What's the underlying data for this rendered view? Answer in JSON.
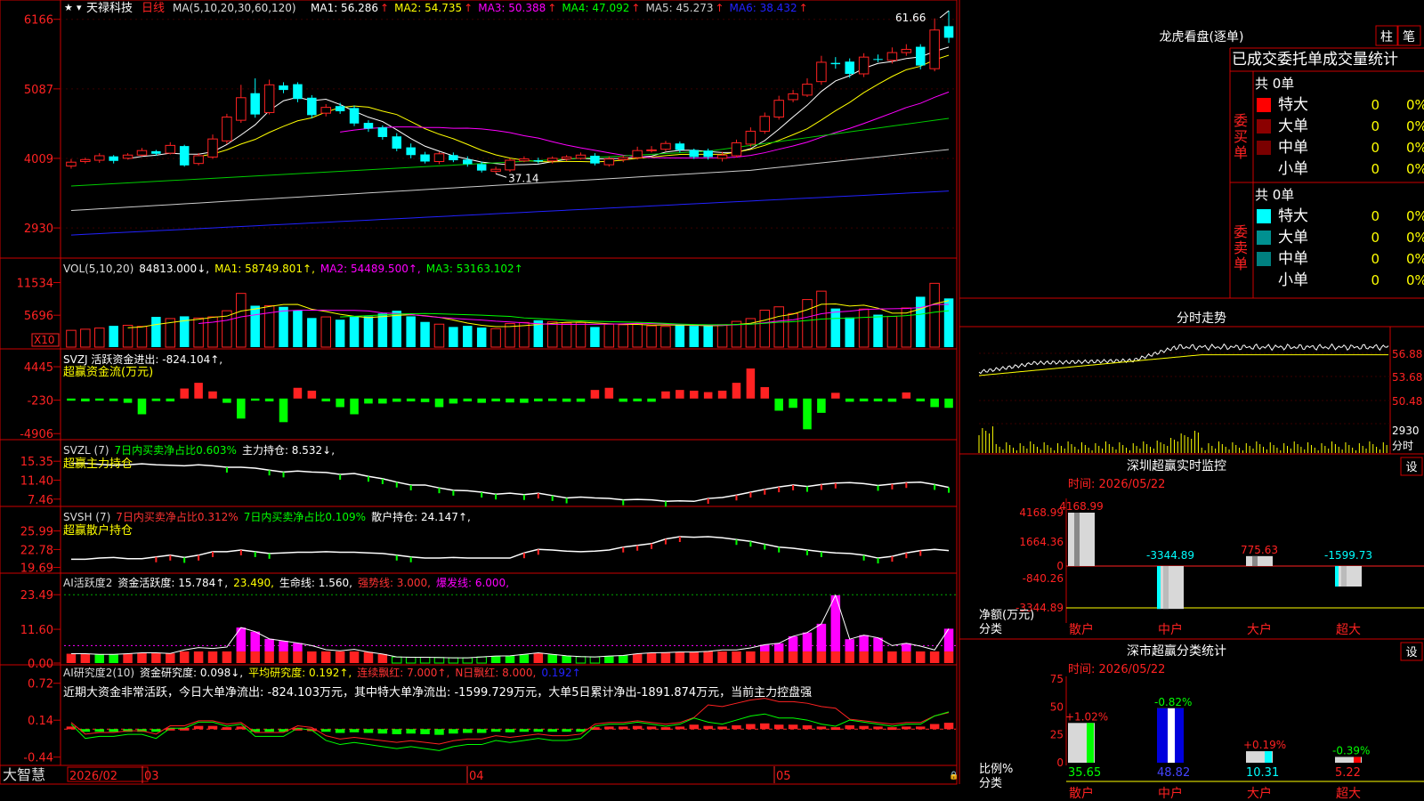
{
  "header": {
    "stock_name": "天禄科技",
    "period": "日线",
    "ma_label": "MA(5,10,20,30,60,120)",
    "ma": [
      {
        "t": "MA1: 56.286",
        "c": "#ffffff",
        "a": "up"
      },
      {
        "t": "MA2: 54.735",
        "c": "#ffff00",
        "a": "up"
      },
      {
        "t": "MA3: 50.388",
        "c": "#ff00ff",
        "a": "up"
      },
      {
        "t": "MA4: 47.092",
        "c": "#00ff00",
        "a": "up"
      },
      {
        "t": "MA5: 45.273",
        "c": "#cccccc",
        "a": "up"
      },
      {
        "t": "MA6: 38.432",
        "c": "#2222ff",
        "a": "up"
      }
    ]
  },
  "arrows": {
    "up": "↑",
    "down": "↓"
  },
  "panels": [
    {
      "id": "price",
      "ticks": [
        "6166",
        "5087",
        "4009",
        "2930"
      ]
    },
    {
      "id": "vol",
      "ticks": [
        "11534",
        "5696"
      ],
      "extra": "X10",
      "labels": [
        {
          "t": "VOL(5,10,20)",
          "c": "#dddddd"
        },
        {
          "t": "84813.000↓,",
          "c": "#ffffff"
        },
        {
          "t": "MA1: 58749.801↑,",
          "c": "#ffff00"
        },
        {
          "t": "MA2: 54489.500↑,",
          "c": "#ff00ff"
        },
        {
          "t": "MA3: 53163.102↑",
          "c": "#00ff00"
        }
      ]
    },
    {
      "id": "svzj",
      "ticks": [
        "4445",
        "-230",
        "-4906"
      ],
      "labels": [
        {
          "t": "SVZJ  活跃资金进出: -824.104↑,",
          "c": "#ffffff"
        }
      ],
      "sub": "超赢资金流(万元)"
    },
    {
      "id": "svzl",
      "ticks": [
        "15.35",
        "11.40",
        "7.46"
      ],
      "labels": [
        {
          "t": "SVZL (7)",
          "c": "#dddddd"
        },
        {
          "t": "7日内买卖净占比0.603%",
          "c": "#00ff00"
        },
        {
          "t": "主力持仓: 8.532↓,",
          "c": "#ffffff"
        }
      ],
      "sub": "超赢主力持仓"
    },
    {
      "id": "svsh",
      "ticks": [
        "25.99",
        "22.78",
        "19.69"
      ],
      "labels": [
        {
          "t": "SVSH (7)",
          "c": "#dddddd"
        },
        {
          "t": "7日内买卖净占比0.312%",
          "c": "#ff3333"
        },
        {
          "t": "7日内买卖净占比0.109%",
          "c": "#00ff00"
        },
        {
          "t": "散户持仓: 24.147↑,",
          "c": "#ffffff"
        }
      ],
      "sub": "超赢散户持仓"
    },
    {
      "id": "ai1",
      "ticks": [
        "23.49",
        "11.60",
        "0.00"
      ],
      "labels": [
        {
          "t": "AI活跃度2",
          "c": "#dddddd"
        },
        {
          "t": "资金活跃度: 15.784↑,",
          "c": "#ffffff"
        },
        {
          "t": "23.490,",
          "c": "#ffff00"
        },
        {
          "t": "生命线: 1.560,",
          "c": "#ffffff"
        },
        {
          "t": "强势线: 3.000,",
          "c": "#ff3333"
        },
        {
          "t": "爆发线: 6.000,",
          "c": "#ff00ff"
        }
      ]
    },
    {
      "id": "ai2",
      "ticks": [
        "0.72",
        "0.14",
        "-0.44"
      ],
      "labels": [
        {
          "t": "AI研究度2(10)",
          "c": "#dddddd"
        },
        {
          "t": "资金研究度: 0.098↓,",
          "c": "#ffffff"
        },
        {
          "t": "平均研究度: 0.192↑,",
          "c": "#ffff00"
        },
        {
          "t": "连续飘红: 7.000↑,",
          "c": "#ff3333"
        },
        {
          "t": "N日飘红: 8.000,",
          "c": "#ff3333"
        },
        {
          "t": "0.192↑",
          "c": "#2222ff"
        }
      ],
      "sub": "近期大资金非常活跃，今日大单净流出: -824.103万元，其中特大单净流出: -1599.729万元，大单5日累计净出-1891.874万元，当前主力控盘强"
    }
  ],
  "annotations": {
    "high": "61.66",
    "low": "37.14"
  },
  "bottom": {
    "brand": "大智慧",
    "dates": [
      "2026/02",
      "03",
      "04",
      "05"
    ]
  },
  "longhu": {
    "title": "龙虎看盘(逐单)",
    "btn1": "柱",
    "btn2": "笔",
    "header": "已成交委托单成交量统计",
    "buy": {
      "label": "委买单",
      "total": "共 0单",
      "rows": [
        {
          "name": "特大",
          "val": "0",
          "pct": "0%",
          "c": "#ff0000"
        },
        {
          "name": "大单",
          "val": "0",
          "pct": "0%",
          "c": "#8b0000"
        },
        {
          "name": "中单",
          "val": "0",
          "pct": "0%",
          "c": "#7a0000"
        },
        {
          "name": "小单",
          "val": "0",
          "pct": "0%",
          "c": ""
        }
      ]
    },
    "sell": {
      "label": "委卖单",
      "total": "共 0单",
      "rows": [
        {
          "name": "特大",
          "val": "0",
          "pct": "0%",
          "c": "#00ffff"
        },
        {
          "name": "大单",
          "val": "0",
          "pct": "0%",
          "c": "#009090"
        },
        {
          "name": "中单",
          "val": "0",
          "pct": "0%",
          "c": "#008080"
        },
        {
          "name": "小单",
          "val": "0",
          "pct": "0%",
          "c": ""
        }
      ]
    }
  },
  "minute": {
    "title": "分时走势",
    "ticks": [
      "56.88",
      "53.68",
      "50.48"
    ],
    "vol_tick": "2930",
    "vol_unit": "分时"
  },
  "monitor": {
    "title": "深圳超赢实时监控",
    "btn": "设",
    "time": "时间: 2026/05/22",
    "ticks": [
      "4168.99",
      "1664.36",
      "0",
      "-840.26",
      "-3344.89"
    ],
    "ylabel": "净额(万元)",
    "xlabel": "分类",
    "cats": [
      "散户",
      "中户",
      "大户",
      "超大"
    ],
    "vals": [
      "4168.99",
      "-3344.89",
      "775.63",
      "-1599.73"
    ]
  },
  "classify": {
    "title": "深市超赢分类统计",
    "btn": "设",
    "time": "时间: 2026/05/22",
    "ticks": [
      "75",
      "50",
      "25",
      "0"
    ],
    "ylabel": "比例%",
    "xlabel": "分类",
    "cats": [
      "散户",
      "中户",
      "大户",
      "超大"
    ],
    "vals": [
      "35.65",
      "48.82",
      "10.31",
      "5.22"
    ],
    "chg": [
      "+1.02%",
      "-0.82%",
      "+0.19%",
      "-0.39%"
    ]
  },
  "chart_data": [
    {
      "type": "candlestick",
      "title": "天禄科技 日线",
      "x": [
        "2026/02",
        "03",
        "04",
        "05"
      ],
      "yticks": [
        2930,
        4009,
        5087,
        6166
      ],
      "ylim": [
        2600,
        6300
      ],
      "high_label": 61.66,
      "low_label": 37.14,
      "o": [
        3890,
        3960,
        3980,
        4040,
        4010,
        4060,
        4120,
        4090,
        4200,
        3930,
        4030,
        4280,
        4600,
        5020,
        4720,
        5140,
        5160,
        4950,
        4710,
        4820,
        4790,
        4560,
        4490,
        4350,
        4180,
        4070,
        3960,
        4060,
        3990,
        3920,
        3810,
        3830,
        3970,
        3980,
        3970,
        4000,
        4010,
        4050,
        3910,
        3990,
        4020,
        4140,
        4150,
        4240,
        4140,
        4130,
        4010,
        4050,
        4230,
        4430,
        4650,
        4920,
        4990,
        5200,
        5490,
        5510,
        5320,
        5550,
        5530,
        5650,
        5740,
        5400,
        6060
      ],
      "c": [
        3950,
        3990,
        4050,
        3970,
        4060,
        4130,
        4080,
        4210,
        3900,
        4050,
        4310,
        4650,
        4950,
        4690,
        5150,
        5070,
        4930,
        4680,
        4800,
        4740,
        4550,
        4470,
        4340,
        4160,
        4060,
        3960,
        4080,
        3980,
        3920,
        3820,
        3840,
        3980,
        4000,
        3960,
        4010,
        4030,
        4060,
        3930,
        4000,
        4020,
        4130,
        4140,
        4240,
        4140,
        4030,
        4030,
        4060,
        4250,
        4430,
        4660,
        4910,
        5010,
        5160,
        5500,
        5470,
        5320,
        5580,
        5540,
        5650,
        5700,
        5450,
        6000,
        5880
      ],
      "h": [
        4000,
        4020,
        4090,
        4060,
        4090,
        4170,
        4140,
        4260,
        4220,
        4090,
        4380,
        4700,
        5150,
        5250,
        5230,
        5190,
        5190,
        4990,
        4850,
        4870,
        4830,
        4600,
        4520,
        4400,
        4240,
        4110,
        4110,
        4100,
        4040,
        3960,
        3880,
        4010,
        4040,
        4020,
        4040,
        4060,
        4100,
        4090,
        4040,
        4050,
        4190,
        4200,
        4280,
        4270,
        4160,
        4160,
        4110,
        4300,
        4490,
        4720,
        4980,
        5070,
        5250,
        5600,
        5580,
        5560,
        5640,
        5620,
        5730,
        5780,
        5780,
        6180,
        6300
      ],
      "l": [
        3850,
        3930,
        3940,
        3930,
        3990,
        4040,
        4050,
        4070,
        3880,
        3900,
        4000,
        4230,
        4560,
        4640,
        4690,
        5020,
        4880,
        4630,
        4660,
        4700,
        4510,
        4420,
        4300,
        4120,
        4010,
        3930,
        3920,
        3950,
        3880,
        3790,
        3770,
        3800,
        3950,
        3930,
        3930,
        3970,
        3990,
        3900,
        3880,
        3950,
        3990,
        4100,
        4120,
        4100,
        4000,
        3990,
        3960,
        4020,
        4190,
        4390,
        4610,
        4880,
        4960,
        5150,
        5400,
        5260,
        5270,
        5500,
        5480,
        5600,
        5390,
        5360,
        5800
      ]
    },
    {
      "type": "bar",
      "title": "VOL(5,10,20)",
      "yticks": [
        5696,
        11534
      ],
      "ylim": [
        0,
        14000
      ],
      "values": [
        3000,
        3200,
        3400,
        3800,
        3900,
        3700,
        5400,
        5100,
        5500,
        5200,
        5400,
        6500,
        9600,
        7400,
        7400,
        7200,
        6600,
        5200,
        5400,
        4900,
        5400,
        5500,
        6000,
        6500,
        5500,
        4500,
        4100,
        3600,
        3800,
        3500,
        3300,
        4200,
        4400,
        4800,
        4500,
        4300,
        4400,
        3600,
        4100,
        4000,
        4200,
        3800,
        3700,
        4000,
        3800,
        3800,
        4000,
        4600,
        5100,
        6600,
        7200,
        6000,
        8500,
        10000,
        6900,
        5300,
        6800,
        5800,
        5500,
        7000,
        9000,
        11400,
        8700
      ]
    },
    {
      "type": "bar",
      "title": "超赢资金流(万元)",
      "yticks": [
        -4906,
        -230,
        4445
      ],
      "ylim": [
        -5500,
        5200
      ],
      "values": [
        -300,
        -400,
        -300,
        -350,
        -600,
        -2200,
        -350,
        -400,
        1400,
        2200,
        1000,
        -600,
        -2800,
        -300,
        -400,
        -3300,
        1500,
        1100,
        -400,
        -1200,
        -2200,
        -700,
        -700,
        -450,
        -400,
        -500,
        -1200,
        -700,
        -400,
        -600,
        -400,
        -550,
        -600,
        -400,
        -350,
        -450,
        -450,
        1200,
        1500,
        -450,
        -400,
        -450,
        1000,
        1200,
        1100,
        900,
        1100,
        2200,
        4200,
        1600,
        -1700,
        -1300,
        -4300,
        -2000,
        800,
        -450,
        -400,
        -400,
        -450,
        850,
        -400,
        -1200,
        -1300
      ]
    },
    {
      "type": "line",
      "title": "超赢主力持仓",
      "yticks": [
        7.46,
        11.4,
        15.35
      ],
      "ylim": [
        6.5,
        16.5
      ],
      "values": [
        14.9,
        14.9,
        14.7,
        14.5,
        14.6,
        14.8,
        14.6,
        14.5,
        14.4,
        14.6,
        14.4,
        14.1,
        14.1,
        13.9,
        13.5,
        13.1,
        13.3,
        13.1,
        13.0,
        12.6,
        12.8,
        12.2,
        11.7,
        11.0,
        10.4,
        10.4,
        9.8,
        9.3,
        9.2,
        8.9,
        8.5,
        8.7,
        8.4,
        8.7,
        8.2,
        7.7,
        7.9,
        7.7,
        7.6,
        7.3,
        7.4,
        7.3,
        7.0,
        7.1,
        7.0,
        7.6,
        7.8,
        8.3,
        8.9,
        9.5,
        10.0,
        10.4,
        10.1,
        10.5,
        10.8,
        10.9,
        10.7,
        10.3,
        10.6,
        10.9,
        11.0,
        10.5,
        9.9
      ]
    },
    {
      "type": "line",
      "title": "超赢散户持仓",
      "yticks": [
        19.69,
        22.78,
        25.99
      ],
      "ylim": [
        19,
        27
      ],
      "values": [
        21.1,
        21.1,
        21.3,
        21.4,
        21.2,
        21.2,
        21.5,
        21.8,
        21.4,
        21.8,
        22.4,
        22.4,
        22.7,
        22.4,
        22.1,
        22.2,
        22.3,
        22.3,
        22.4,
        22.3,
        22.3,
        22.2,
        22.1,
        21.8,
        21.5,
        21.3,
        21.3,
        21.4,
        21.3,
        21.3,
        21.3,
        21.3,
        22.2,
        22.8,
        22.7,
        22.5,
        22.4,
        22.5,
        22.7,
        23.2,
        23.5,
        23.8,
        24.6,
        25.0,
        24.9,
        25.0,
        24.8,
        24.5,
        24.2,
        23.7,
        23.2,
        23.0,
        22.7,
        22.4,
        22.2,
        22.1,
        21.8,
        21.3,
        21.6,
        22.2,
        22.6,
        22.8,
        22.6
      ]
    },
    {
      "type": "bar",
      "title": "AI活跃度2",
      "yticks": [
        0,
        11.6,
        23.49
      ],
      "ylim": [
        0,
        26
      ],
      "values": [
        3.2,
        3.2,
        3.0,
        3.0,
        3.2,
        3.5,
        3.5,
        3.3,
        4.5,
        5.3,
        5.0,
        5.5,
        12.2,
        10.8,
        8.3,
        7.6,
        6.9,
        6.0,
        4.6,
        4.2,
        4.7,
        3.8,
        3.1,
        2.1,
        2.0,
        2.0,
        1.9,
        1.8,
        1.8,
        2.1,
        2.4,
        2.5,
        3.0,
        3.5,
        3.0,
        2.5,
        2.2,
        2.1,
        2.4,
        2.6,
        3.2,
        3.5,
        3.6,
        3.8,
        3.8,
        4.0,
        4.5,
        4.5,
        5.2,
        6.3,
        6.8,
        9.2,
        10.5,
        13.5,
        23.3,
        8.2,
        9.6,
        8.7,
        6.0,
        6.8,
        5.8,
        4.5,
        11.8
      ]
    },
    {
      "type": "bar",
      "title": "AI研究度2(10)",
      "yticks": [
        -0.44,
        0.14,
        0.72
      ],
      "ylim": [
        -0.5,
        0.8
      ],
      "values": [
        0.04,
        -0.03,
        -0.02,
        -0.02,
        -0.01,
        -0.01,
        -0.03,
        0.02,
        0.02,
        0.05,
        0.05,
        0.03,
        0.04,
        -0.02,
        -0.02,
        -0.02,
        0.02,
        0.01,
        -0.04,
        -0.06,
        -0.05,
        -0.06,
        -0.07,
        -0.08,
        -0.07,
        -0.08,
        -0.09,
        -0.07,
        -0.06,
        -0.06,
        -0.04,
        -0.05,
        -0.04,
        -0.03,
        -0.04,
        -0.04,
        -0.03,
        0.03,
        0.04,
        0.04,
        0.05,
        0.04,
        0.03,
        0.04,
        0.07,
        0.05,
        0.04,
        0.06,
        0.08,
        0.09,
        0.07,
        0.07,
        0.06,
        0.04,
        0.03,
        0.06,
        0.05,
        0.04,
        0.03,
        0.04,
        0.04,
        0.08,
        0.1
      ]
    }
  ]
}
